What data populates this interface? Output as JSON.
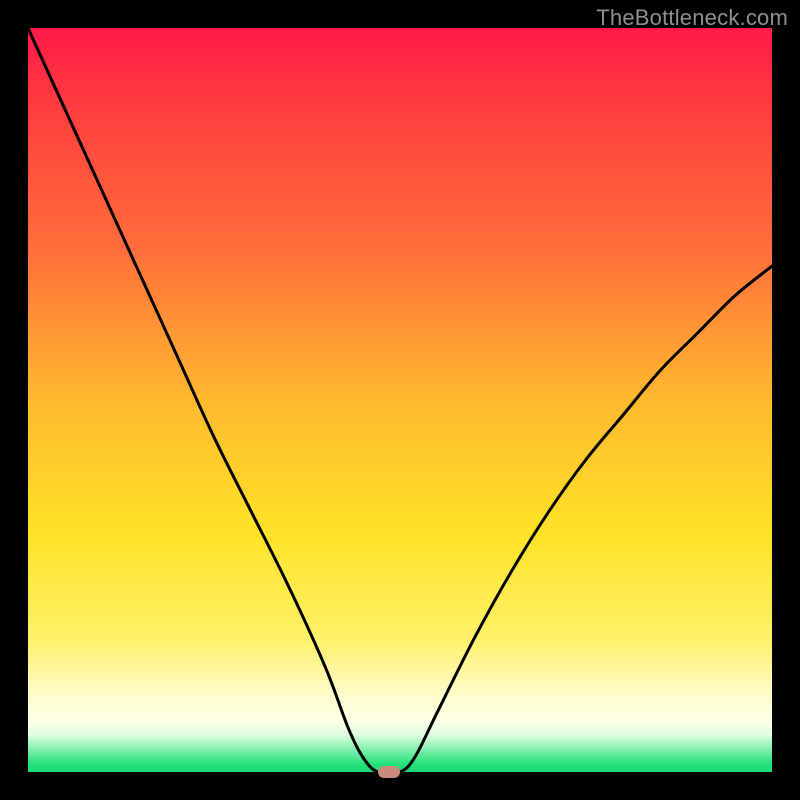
{
  "watermark": "TheBottleneck.com",
  "colors": {
    "frame": "#000000",
    "gradient_top": "#ff1a47",
    "gradient_mid_upper": "#ff6f3a",
    "gradient_mid": "#ffe227",
    "gradient_lower": "#fffccf",
    "gradient_bottom": "#1cd975",
    "curve": "#000000",
    "marker": "#c98a7d"
  },
  "chart_data": {
    "type": "line",
    "title": "",
    "xlabel": "",
    "ylabel": "",
    "xlim": [
      0,
      100
    ],
    "ylim": [
      0,
      100
    ],
    "grid": false,
    "legend": false,
    "annotations": [
      {
        "text": "TheBottleneck.com",
        "position": "top-right"
      }
    ],
    "series": [
      {
        "name": "bottleneck-curve",
        "x": [
          0,
          5,
          10,
          15,
          20,
          25,
          30,
          35,
          40,
          43,
          45,
          47,
          50,
          52,
          55,
          60,
          65,
          70,
          75,
          80,
          85,
          90,
          95,
          100
        ],
        "values": [
          100,
          89,
          78,
          67,
          56,
          45,
          35,
          25,
          14,
          6,
          2,
          0,
          0,
          2,
          8,
          18,
          27,
          35,
          42,
          48,
          54,
          59,
          64,
          68
        ]
      }
    ],
    "minimum_marker": {
      "x": 48.5,
      "y": 0
    }
  }
}
